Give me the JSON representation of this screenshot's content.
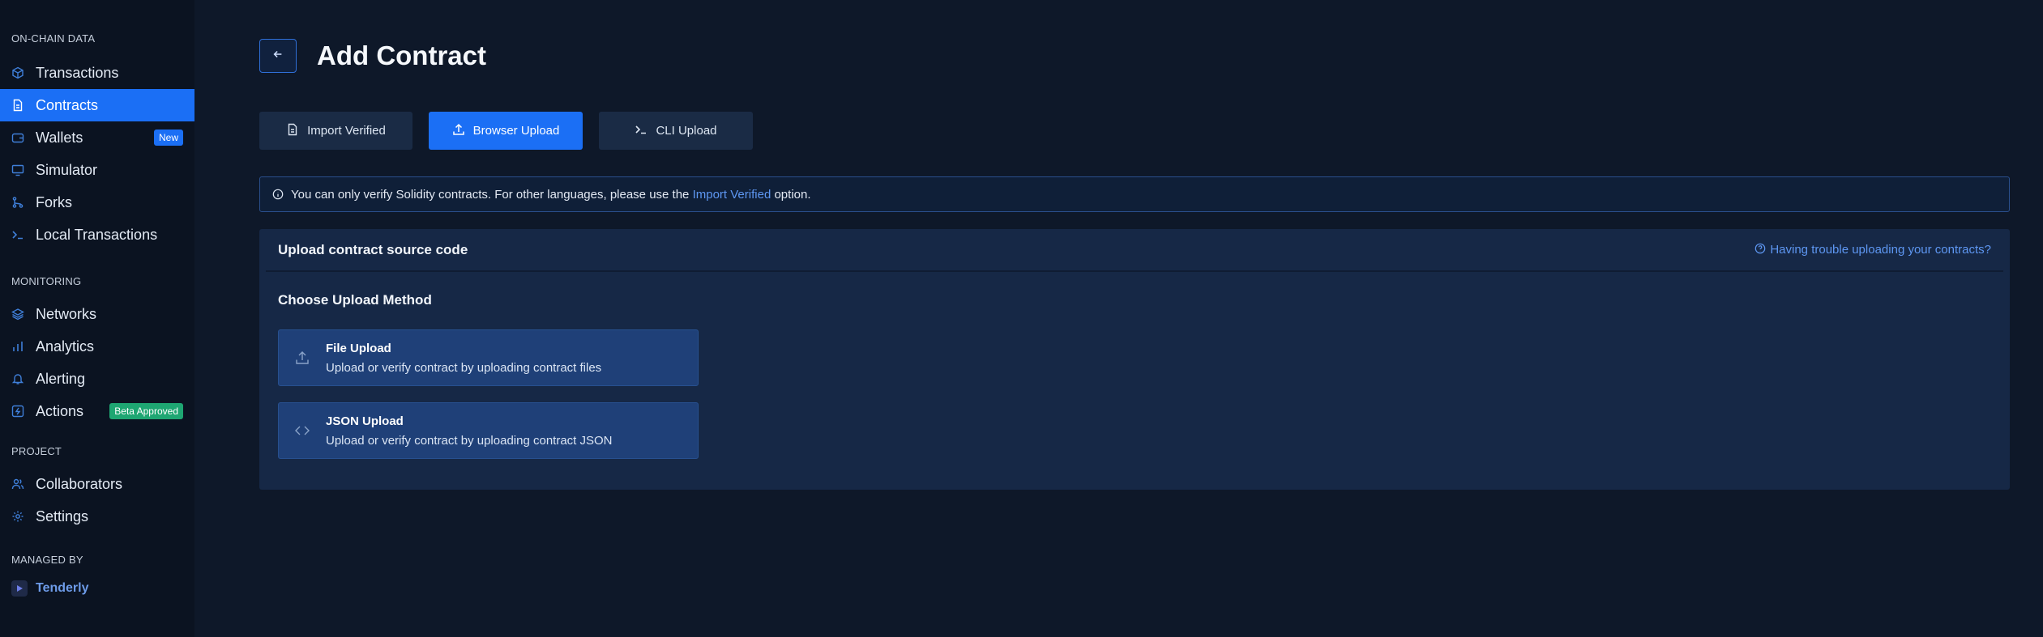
{
  "sidebar": {
    "sections": [
      {
        "label": "ON-CHAIN DATA",
        "items": [
          {
            "label": "Transactions",
            "icon": "cube-icon"
          },
          {
            "label": "Contracts",
            "icon": "document-icon",
            "active": true
          },
          {
            "label": "Wallets",
            "icon": "wallet-icon",
            "badge": "New"
          },
          {
            "label": "Simulator",
            "icon": "monitor-icon"
          },
          {
            "label": "Forks",
            "icon": "fork-icon"
          },
          {
            "label": "Local Transactions",
            "icon": "terminal-icon"
          }
        ]
      },
      {
        "label": "MONITORING",
        "items": [
          {
            "label": "Networks",
            "icon": "layers-icon"
          },
          {
            "label": "Analytics",
            "icon": "bar-chart-icon"
          },
          {
            "label": "Alerting",
            "icon": "bell-icon"
          },
          {
            "label": "Actions",
            "icon": "lightning-icon",
            "badge": "Beta Approved"
          }
        ]
      },
      {
        "label": "PROJECT",
        "items": [
          {
            "label": "Collaborators",
            "icon": "users-icon"
          },
          {
            "label": "Settings",
            "icon": "gear-icon"
          }
        ]
      }
    ],
    "managed_by_label": "MANAGED BY",
    "brand": "Tenderly"
  },
  "header": {
    "title": "Add Contract"
  },
  "tabs": [
    {
      "label": "Import Verified",
      "icon": "file-icon"
    },
    {
      "label": "Browser Upload",
      "icon": "upload-icon",
      "active": true
    },
    {
      "label": "CLI Upload",
      "icon": "terminal-icon"
    }
  ],
  "info": {
    "text_before": "You can only verify Solidity contracts. For other languages, please use the ",
    "link": "Import Verified",
    "text_after": " option."
  },
  "panel": {
    "title": "Upload contract source code",
    "help_link": "Having trouble uploading your contracts?",
    "section_title": "Choose Upload Method",
    "options": [
      {
        "title": "File Upload",
        "description": "Upload or verify contract by uploading contract files",
        "icon": "upload-icon"
      },
      {
        "title": "JSON Upload",
        "description": "Upload or verify contract by uploading contract JSON",
        "icon": "code-icon"
      }
    ]
  },
  "colors": {
    "accent": "#1b6ff5",
    "background": "#0e1829",
    "sidebar": "#0b1321",
    "badge_beta": "#1ea672"
  }
}
